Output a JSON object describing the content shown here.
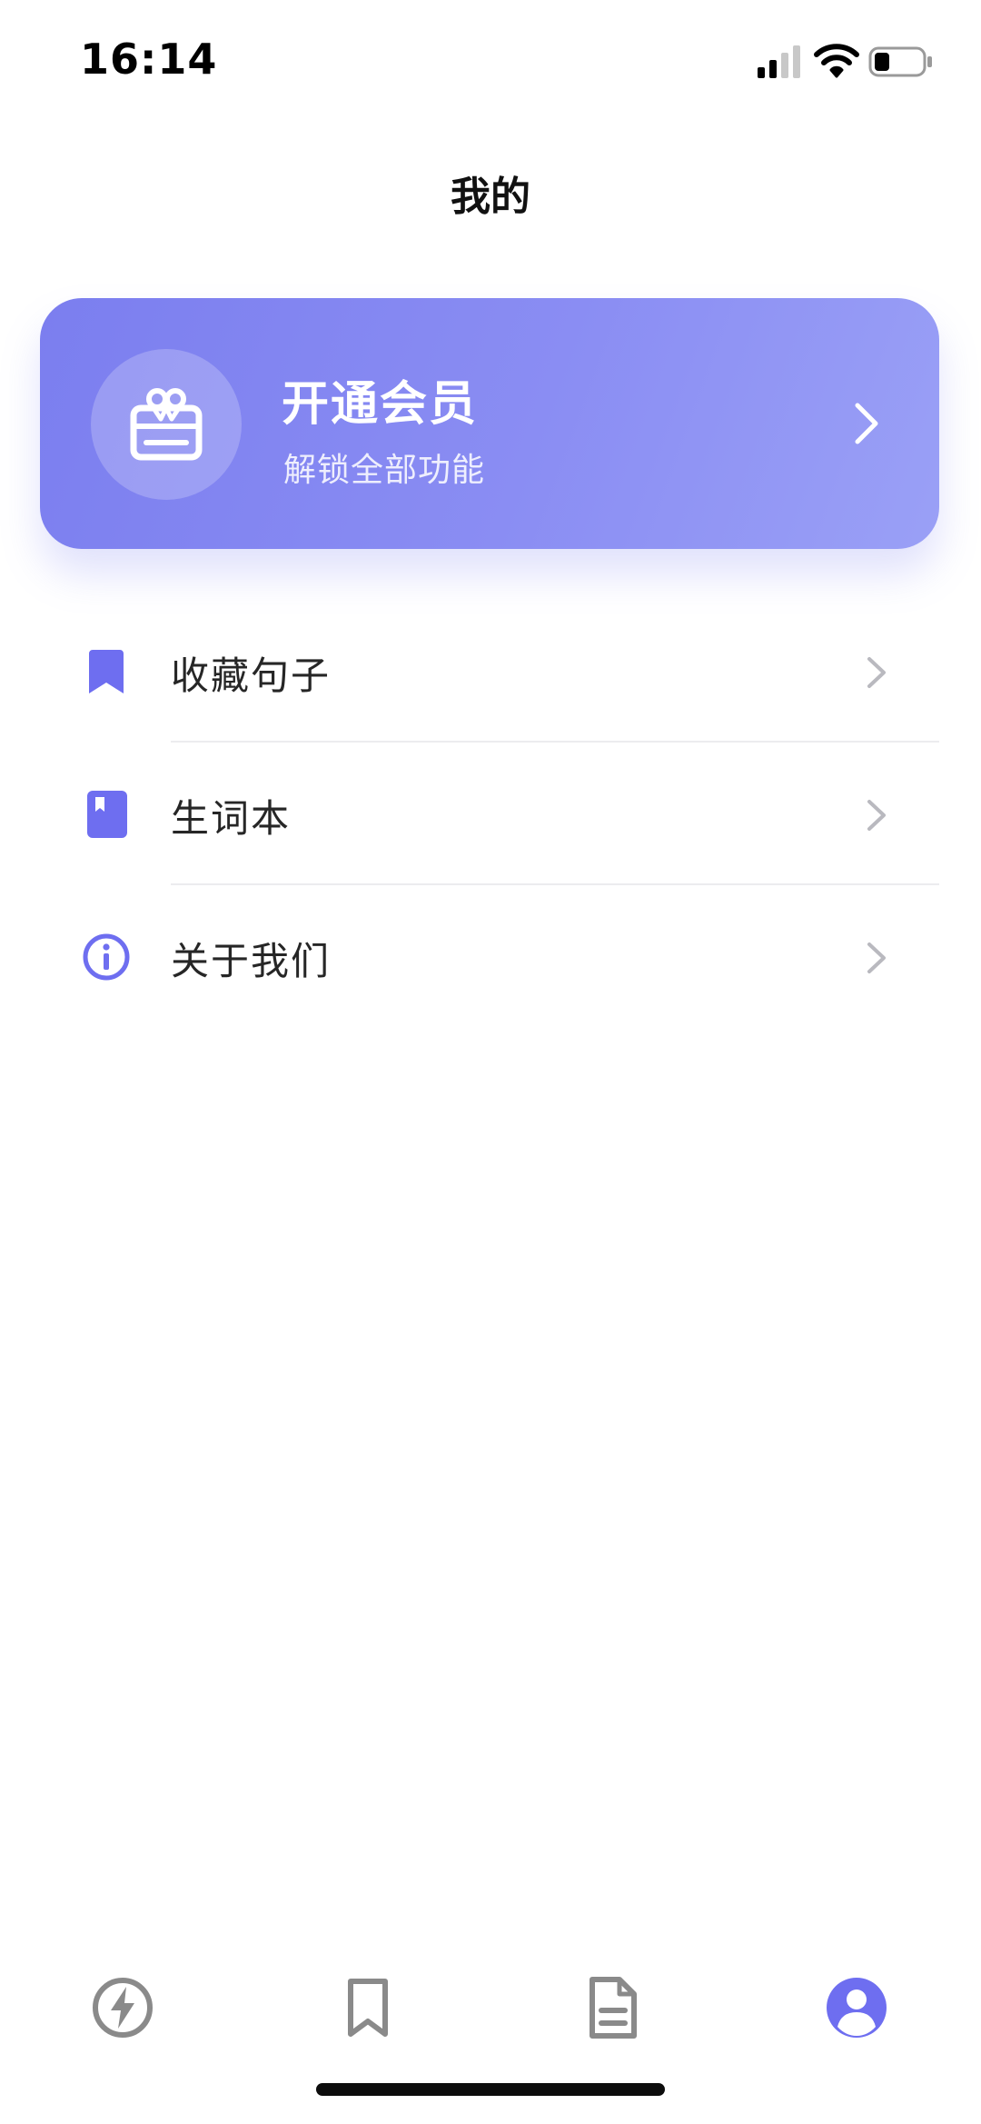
{
  "status_bar": {
    "time": "16:14"
  },
  "header": {
    "title": "我的"
  },
  "member_card": {
    "title": "开通会员",
    "subtitle": "解锁全部功能",
    "icon": "gift-card-icon"
  },
  "menu": {
    "items": [
      {
        "label": "收藏句子",
        "icon": "bookmark-icon"
      },
      {
        "label": "生词本",
        "icon": "notebook-icon"
      },
      {
        "label": "关于我们",
        "icon": "info-icon"
      }
    ]
  },
  "tab_bar": {
    "tabs": [
      {
        "icon": "lightning-icon",
        "active": false
      },
      {
        "icon": "bookmark-outline-icon",
        "active": false
      },
      {
        "icon": "document-icon",
        "active": false
      },
      {
        "icon": "profile-icon",
        "active": true
      }
    ]
  },
  "colors": {
    "accent": "#6e6ef0",
    "card_gradient_start": "#7b7eef",
    "card_gradient_end": "#9aa0f6",
    "tab_inactive": "#8a8a8a",
    "divider": "#ececef"
  }
}
